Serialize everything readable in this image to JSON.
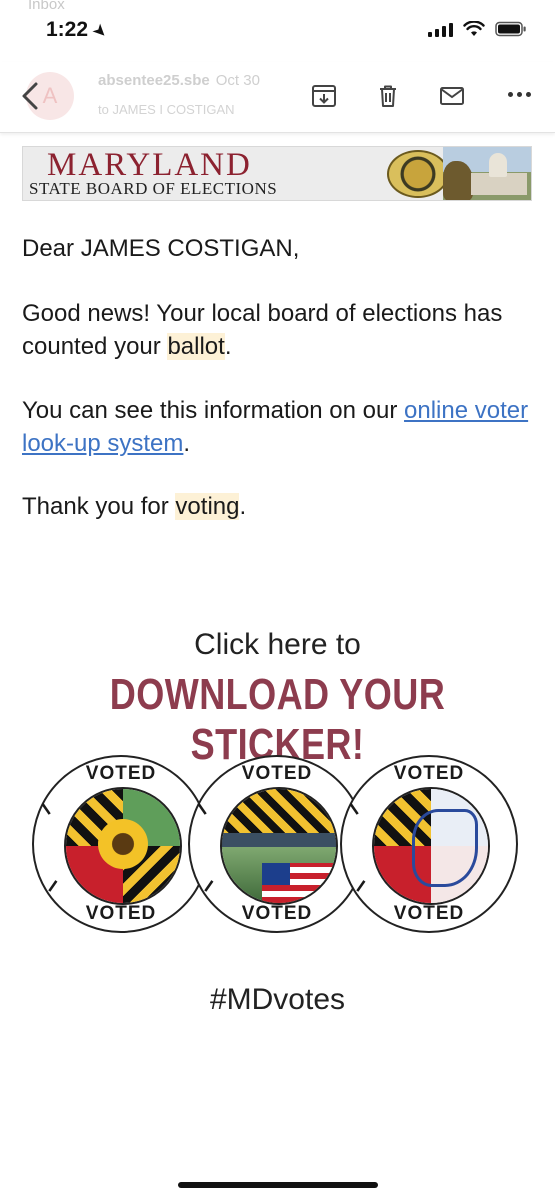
{
  "status_bar": {
    "time": "1:22",
    "back_app": "Inbox"
  },
  "header": {
    "avatar_letter": "A",
    "sender": "absentee25.sbe",
    "date": "Oct 30",
    "recipient": "to JAMES I COSTIGAN"
  },
  "banner": {
    "title": "MARYLAND",
    "subtitle": "STATE BOARD OF ELECTIONS"
  },
  "email": {
    "greeting": "Dear JAMES COSTIGAN,",
    "p1_before": "Good news! Your local board of elections has counted your ",
    "p1_highlight": "ballot",
    "p1_after": ".",
    "p2_before": "You can see this information on our ",
    "p2_link": "online voter look-up system",
    "p2_after": ".",
    "p3_before": "Thank you for ",
    "p3_highlight": "voting",
    "p3_after": "."
  },
  "sticker_block": {
    "click_here": "Click here to",
    "download": "DOWNLOAD YOUR STICKER!",
    "sticker_top": "VOTED",
    "sticker_bottom": "VOTED",
    "sticker_i": "I",
    "hashtag": "#MDvotes"
  },
  "colors": {
    "brand_red": "#8c2230",
    "download_text": "#8d3c4e",
    "link": "#3d73c4",
    "highlight": "#fdf1d6"
  }
}
